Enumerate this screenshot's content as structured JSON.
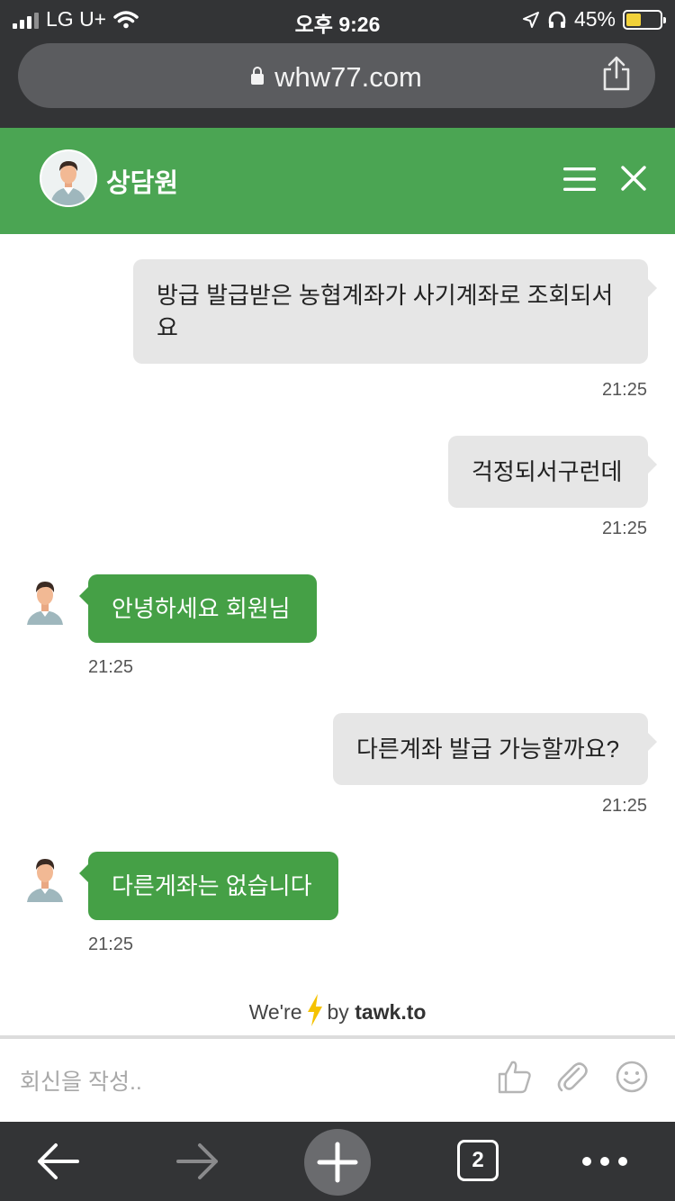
{
  "status_bar": {
    "carrier": "LG U+",
    "time": "오후 9:26",
    "battery": "45%",
    "battery_level": 0.45
  },
  "browser": {
    "url": "whw77.com",
    "tab_count": "2"
  },
  "chat_header": {
    "agent_name": "상담원"
  },
  "messages": [
    {
      "sender": "visitor",
      "text": "방급 발급받은 농협계좌가 사기계좌로 조회되서요",
      "time": "21:25"
    },
    {
      "sender": "visitor",
      "text": "걱정되서구런데",
      "time": "21:25"
    },
    {
      "sender": "agent",
      "text": "안녕하세요 회원님",
      "time": "21:25"
    },
    {
      "sender": "visitor",
      "text": "다른계좌 발급 가능할까요?",
      "time": "21:25"
    },
    {
      "sender": "agent",
      "text": "다른게좌는 없습니다",
      "time": "21:25"
    }
  ],
  "branding": {
    "prefix": "We're",
    "by": "by",
    "brand": "tawk.to"
  },
  "composer": {
    "placeholder": "회신을 작성.."
  },
  "colors": {
    "header_green": "#4ba553",
    "agent_bubble": "#45a046",
    "visitor_bubble": "#e6e6e6",
    "browser_chrome": "#333436",
    "bolt": "#f5c200"
  },
  "icons": {
    "header": [
      "agent-avatar",
      "menu-icon",
      "close-icon"
    ],
    "composer": [
      "thumbs-up-icon",
      "paperclip-icon",
      "smiley-icon"
    ],
    "toolbar": [
      "back-arrow-icon",
      "forward-arrow-icon",
      "plus-icon",
      "tabs-icon",
      "more-icon"
    ]
  }
}
